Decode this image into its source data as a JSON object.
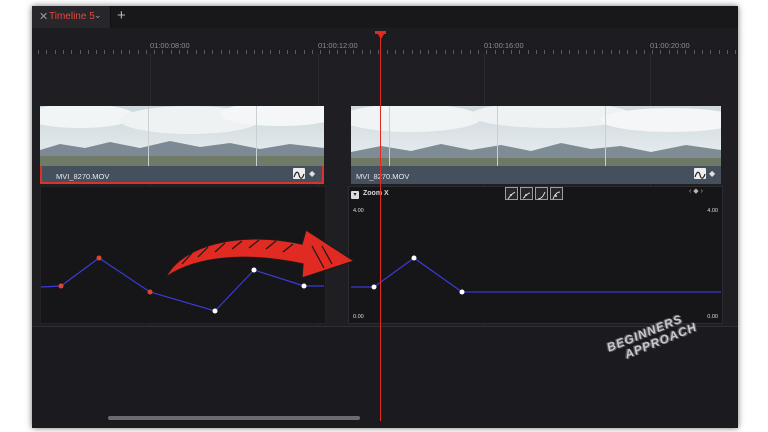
{
  "tab": {
    "close": "✕",
    "title": "Timeline 5",
    "chevron": "⌄",
    "add": "+"
  },
  "ruler": {
    "timecodes": [
      "01:00:08:00",
      "01:00:12:00",
      "01:00:16:00",
      "01:00:20:00"
    ]
  },
  "clips": [
    {
      "name": "MVI_8270.MOV",
      "selected": true
    },
    {
      "name": "MVI_8270.MOV",
      "selected": false
    }
  ],
  "curve_editor": {
    "parameter": "Zoom X",
    "max_left": "4.00",
    "max_right": "4.00",
    "min_left": "0.00",
    "min_right": "0.00",
    "nav": "‹ ◆ ›"
  },
  "watermark": {
    "line1": "BEGINNERS",
    "line2": "APPROACH"
  },
  "colors": {
    "accent": "#e02a22",
    "curve": "#3b3bd6",
    "clip_bar": "#44505e"
  }
}
